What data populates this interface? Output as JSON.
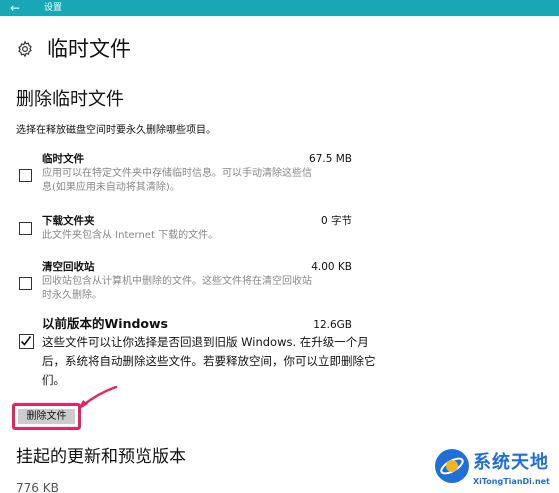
{
  "titlebar": {
    "back_icon": "back-arrow-icon",
    "title": "设置",
    "color": "#17a7b5"
  },
  "page": {
    "icon": "gear-icon",
    "title": "临时文件"
  },
  "section": {
    "title": "删除临时文件",
    "description": "选择在释放磁盘空间时要永久删除哪些项目。"
  },
  "items": [
    {
      "name": "临时文件",
      "size": "67.5 MB",
      "checked": false,
      "desc_lines": [
        "应用可以在特定文件夹中存储临时信息。可以手动清除这些信",
        "息(如果应用未自动将其清除)。"
      ]
    },
    {
      "name": "下载文件夹",
      "size": "0 字节",
      "checked": false,
      "desc_lines": [
        "此文件夹包含从 Internet 下载的文件。"
      ]
    },
    {
      "name": "清空回收站",
      "size": "4.00 KB",
      "checked": false,
      "desc_lines": [
        "回收站包含从计算机中删除的文件。这些文件将在清空回收站",
        "时永久删除。"
      ]
    },
    {
      "name": "以前版本的Windows",
      "size": "12.6GB",
      "checked": true,
      "desc_lines": [
        "这些文件可以让你选择是否回退到旧版  Windows. 在升级一个月",
        "后，系统将自动删除这些文件。若要释放空间，你可以立即删除它",
        "们。"
      ]
    }
  ],
  "delete_button": {
    "label": "删除文件",
    "highlight_color": "#e8245f"
  },
  "section2": {
    "title": "挂起的更新和预览版本",
    "value": "776 KB"
  },
  "watermark": {
    "title": "系统天地",
    "url": "XiTongTianDi.net",
    "color": "#1f6fd8"
  }
}
